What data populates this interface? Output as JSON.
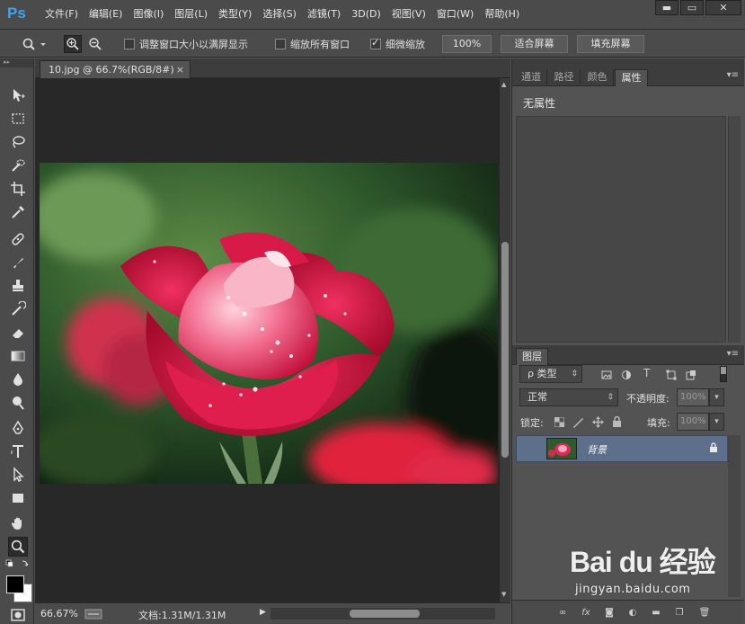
{
  "app": {
    "logo": "Ps",
    "menu": [
      "文件(F)",
      "编辑(E)",
      "图像(I)",
      "图层(L)",
      "类型(Y)",
      "选择(S)",
      "滤镜(T)",
      "3D(D)",
      "视图(V)",
      "窗口(W)",
      "帮助(H)"
    ],
    "window_controls": {
      "minimize": "▬",
      "maximize": "▭",
      "close": "✕"
    }
  },
  "options_bar": {
    "resize_windows_label": "调整窗口大小以满屏显示",
    "resize_windows_checked": false,
    "zoom_all_label": "缩放所有窗口",
    "zoom_all_checked": false,
    "scrubby_zoom_label": "细微缩放",
    "scrubby_zoom_checked": true,
    "btn_100": "100%",
    "btn_fit": "适合屏幕",
    "btn_fill": "填充屏幕"
  },
  "document": {
    "tab_title": "10.jpg @ 66.7%(RGB/8#)",
    "tab_close": "×",
    "status_zoom": "66.67%",
    "status_info": "文档:1.31M/1.31M"
  },
  "properties_panel": {
    "tabs": [
      "通道",
      "路径",
      "颜色",
      "属性"
    ],
    "active_tab": 3,
    "menu_glyph": "▾≡",
    "content_title": "无属性"
  },
  "layers_panel": {
    "tab": "图层",
    "filter_kind": "ρ 类型",
    "blend_mode": "正常",
    "opacity_label": "不透明度:",
    "opacity_value": "100%",
    "lock_label": "锁定:",
    "fill_label": "填充:",
    "fill_value": "100%",
    "layers": [
      {
        "name": "背景",
        "visible": true,
        "locked": true
      }
    ]
  },
  "watermark": {
    "logo": "Bai du 经验",
    "url": "jingyan.baidu.com"
  },
  "colors": {
    "panel_bg": "#535353",
    "chrome": "#4b4b4b",
    "canvas_bg": "#282828",
    "selected_layer": "#5d6f8a",
    "ps_blue": "#3aa6f5"
  }
}
